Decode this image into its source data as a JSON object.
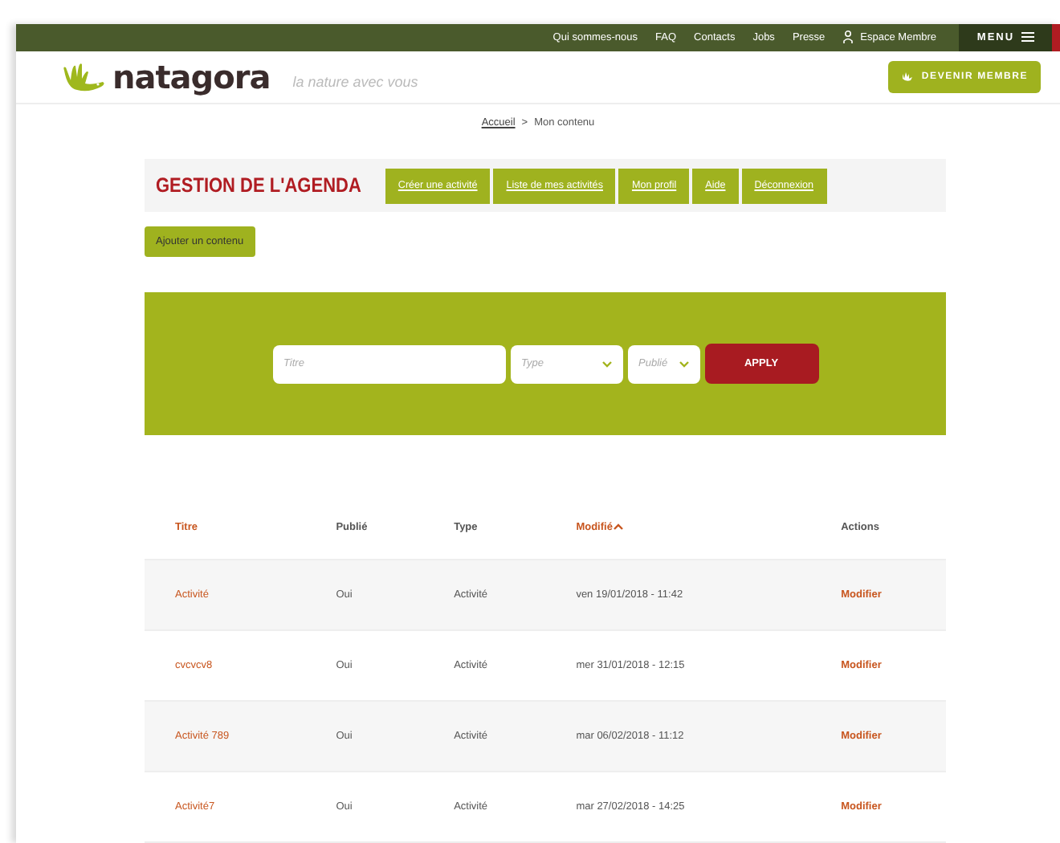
{
  "top_bar": {
    "links": [
      "Qui sommes-nous",
      "FAQ",
      "Contacts",
      "Jobs",
      "Presse"
    ],
    "member_link": "Espace Membre",
    "menu_button": "MENU"
  },
  "header": {
    "logo": "natagora",
    "tagline": "la nature avec vous",
    "cta": "DEVENIR MEMBRE"
  },
  "breadcrumb": [
    {
      "label": "Accueil",
      "link": true
    },
    {
      "label": ">",
      "link": false
    },
    {
      "label": "Mon contenu",
      "link": false
    }
  ],
  "agenda": {
    "title": "GESTION DE L'AGENDA",
    "tabs": [
      "Créer une activité",
      "Liste de mes activités",
      "Mon profil",
      "Aide",
      "Déconnexion"
    ]
  },
  "add_button": "Ajouter un contenu",
  "filter": {
    "title": {
      "placeholder": "Titre"
    },
    "type": {
      "placeholder": "Type"
    },
    "published": {
      "placeholder": "Publié"
    },
    "apply": "APPLY"
  },
  "table": {
    "columns": [
      {
        "label": "Titre",
        "sortable": true,
        "sorted": false
      },
      {
        "label": "Publié",
        "sortable": false,
        "sorted": false
      },
      {
        "label": "Type",
        "sortable": false,
        "sorted": false
      },
      {
        "label": "Modifié",
        "sortable": true,
        "sorted": true
      },
      {
        "label": "Actions",
        "sortable": false,
        "sorted": false
      }
    ],
    "rows": [
      {
        "title": "Activité",
        "published": "Oui",
        "type": "Activité",
        "modified": "ven 19/01/2018 - 11:42",
        "action": "Modifier"
      },
      {
        "title": "cvcvcv8",
        "published": "Oui",
        "type": "Activité",
        "modified": "mer 31/01/2018 - 12:15",
        "action": "Modifier"
      },
      {
        "title": "Activité 789",
        "published": "Oui",
        "type": "Activité",
        "modified": "mar 06/02/2018 - 11:12",
        "action": "Modifier"
      },
      {
        "title": "Activité7",
        "published": "Oui",
        "type": "Activité",
        "modified": "mar 27/02/2018 - 14:25",
        "action": "Modifier"
      }
    ]
  }
}
